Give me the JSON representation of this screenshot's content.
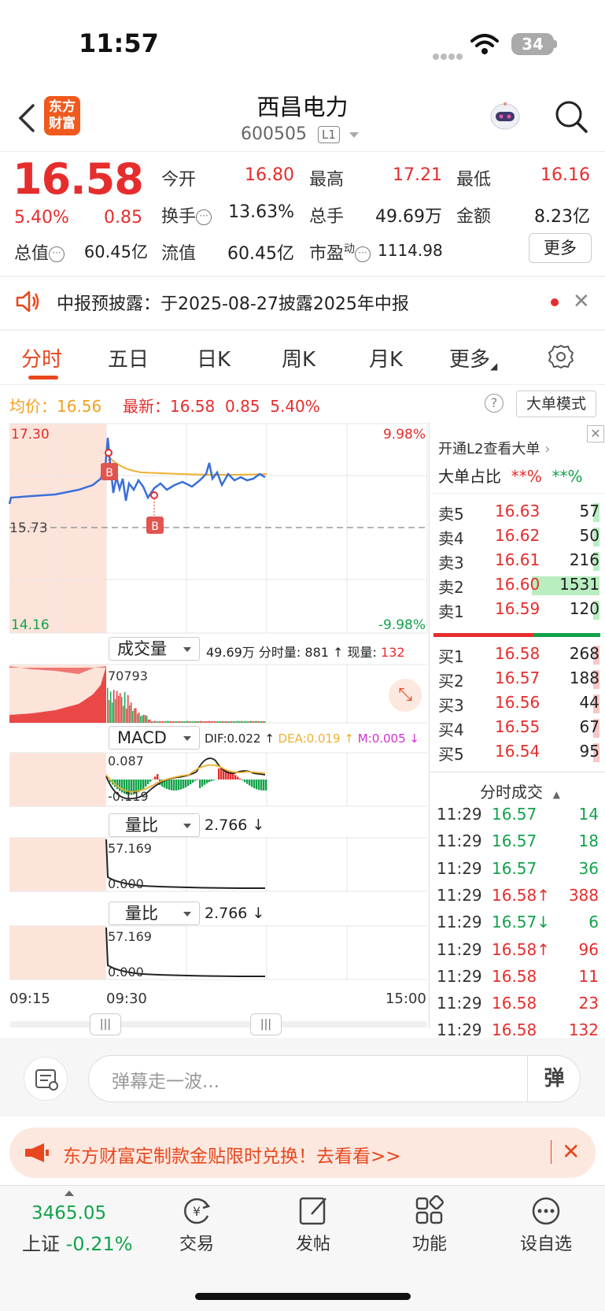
{
  "status_bar": {
    "time": "11:57",
    "battery": "34"
  },
  "header": {
    "logo_line1": "东方",
    "logo_line2": "财富",
    "stock_name": "西昌电力",
    "stock_code": "600505",
    "level": "L1"
  },
  "quote": {
    "price": "16.58",
    "change_pct": "5.40%",
    "change": "0.85",
    "open_label": "今开",
    "open": "16.80",
    "high_label": "最高",
    "high": "17.21",
    "low_label": "最低",
    "low": "16.16",
    "turnover_label": "换手",
    "turnover": "13.63%",
    "volume_label": "总手",
    "volume": "49.69万",
    "amount_label": "金额",
    "amount": "8.23亿",
    "mktcap_label": "总值",
    "mktcap": "60.45亿",
    "float_label": "流值",
    "float": "60.45亿",
    "pe_label": "市盈",
    "pe_sup": "动",
    "pe": "1114.98",
    "more_label": "更多"
  },
  "notice": {
    "text": "中报预披露：于2025-08-27披露2025年中报"
  },
  "tabs": [
    "分时",
    "五日",
    "日K",
    "周K",
    "月K",
    "更多"
  ],
  "info_row": {
    "avg_label": "均价：",
    "avg": "16.56",
    "latest_label": "最新：",
    "latest": "16.58",
    "change": "0.85",
    "pct": "5.40%",
    "mode": "大单模式"
  },
  "chart": {
    "price_top": "17.30",
    "price_bottom": "14.16",
    "price_mid": "15.73",
    "pct_top": "9.98%",
    "pct_bottom": "-9.98%",
    "marker": "B",
    "vol_selector": "成交量",
    "vol_total": "49.69万",
    "vol_minute_label": "分时量:",
    "vol_minute": "881",
    "vol_now_label": "现量:",
    "vol_now": "132",
    "vol_max": "70793",
    "macd_selector": "MACD",
    "dif": "DIF:0.022",
    "dea": "DEA:0.019",
    "m": "M:0.005",
    "macd_top": "0.087",
    "macd_bottom": "-0.119",
    "lb_selector": "量比",
    "lb_value": "2.766",
    "lb_top": "57.169",
    "lb_bottom": "0.000",
    "time_start": "09:15",
    "time_open": "09:30",
    "time_end": "15:00",
    "colors": {
      "price_line": "#3a6fd8",
      "avg_line": "#f0b030",
      "up": "#e62d2d",
      "down": "#12a34a",
      "pre_shade": "#fde4da"
    }
  },
  "order_book": {
    "l2_text": "开通L2查看大单",
    "ratio_label": "大单占比",
    "ratio_buy": "**%",
    "ratio_sell": "**%",
    "asks": [
      {
        "label": "卖5",
        "price": "16.63",
        "vol": "57"
      },
      {
        "label": "卖4",
        "price": "16.62",
        "vol": "50"
      },
      {
        "label": "卖3",
        "price": "16.61",
        "vol": "216"
      },
      {
        "label": "卖2",
        "price": "16.60",
        "vol": "1531"
      },
      {
        "label": "卖1",
        "price": "16.59",
        "vol": "120"
      }
    ],
    "bids": [
      {
        "label": "买1",
        "price": "16.58",
        "vol": "268"
      },
      {
        "label": "买2",
        "price": "16.57",
        "vol": "188"
      },
      {
        "label": "买3",
        "price": "16.56",
        "vol": "44"
      },
      {
        "label": "买4",
        "price": "16.55",
        "vol": "67"
      },
      {
        "label": "买5",
        "price": "16.54",
        "vol": "95"
      }
    ],
    "trades_title": "分时成交",
    "trades": [
      {
        "time": "11:29",
        "price": "16.57",
        "arrow": "",
        "vol": "14",
        "dir": "down"
      },
      {
        "time": "11:29",
        "price": "16.57",
        "arrow": "",
        "vol": "18",
        "dir": "down"
      },
      {
        "time": "11:29",
        "price": "16.57",
        "arrow": "",
        "vol": "36",
        "dir": "down"
      },
      {
        "time": "11:29",
        "price": "16.58",
        "arrow": "↑",
        "vol": "388",
        "dir": "up"
      },
      {
        "time": "11:29",
        "price": "16.57",
        "arrow": "↓",
        "vol": "6",
        "dir": "down"
      },
      {
        "time": "11:29",
        "price": "16.58",
        "arrow": "↑",
        "vol": "96",
        "dir": "up"
      },
      {
        "time": "11:29",
        "price": "16.58",
        "arrow": "",
        "vol": "11",
        "dir": "up"
      },
      {
        "time": "11:29",
        "price": "16.58",
        "arrow": "",
        "vol": "23",
        "dir": "up"
      },
      {
        "time": "11:29",
        "price": "16.58",
        "arrow": "",
        "vol": "132",
        "dir": "up"
      }
    ]
  },
  "danmu": {
    "placeholder": "弹幕走一波...",
    "button": "弹"
  },
  "promo": {
    "text": "东方财富定制款金贴限时兑换！去看看>>"
  },
  "bottom_nav": {
    "index_value": "3465.05",
    "index_name": "上证",
    "index_pct": "-0.21%",
    "items": [
      "交易",
      "发帖",
      "功能",
      "设自选"
    ]
  }
}
